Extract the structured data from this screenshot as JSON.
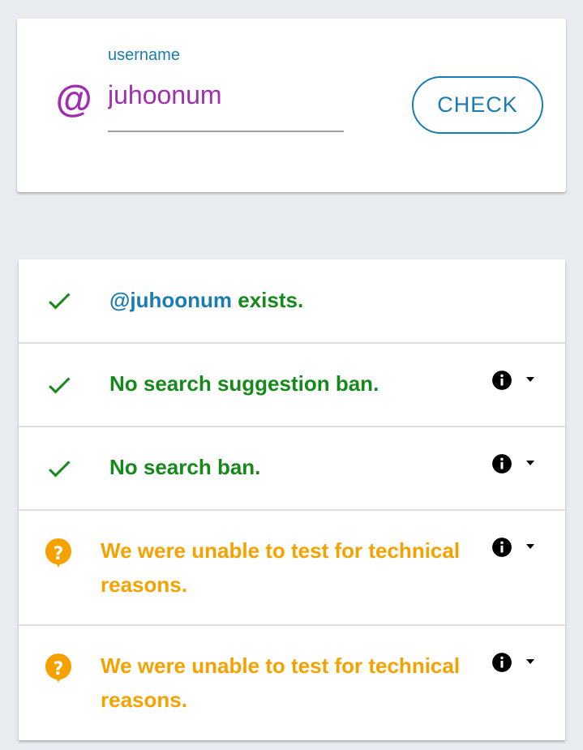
{
  "search": {
    "label": "username",
    "value": "juhoonum",
    "button_label": "CHECK"
  },
  "results": [
    {
      "status": "ok",
      "handle": "@juhoonum",
      "text": "exists."
    },
    {
      "status": "ok",
      "text": "No search suggestion ban."
    },
    {
      "status": "ok",
      "text": "No search ban."
    },
    {
      "status": "unknown",
      "line1": "We were unable to test for technical",
      "line2": "reasons."
    },
    {
      "status": "unknown",
      "line1": "We were unable to test for technical",
      "line2": "reasons."
    }
  ],
  "colors": {
    "accent_blue": "#1a7cb3",
    "at_purple": "#a12eb1",
    "ok_green": "#15891a",
    "unknown_orange": "#f5a200",
    "background": "#e8ecf0"
  },
  "icons": {
    "at": "at-icon",
    "ok": "check-icon",
    "unknown": "question-bubble-icon",
    "info": "info-icon",
    "expand": "caret-down-icon"
  }
}
